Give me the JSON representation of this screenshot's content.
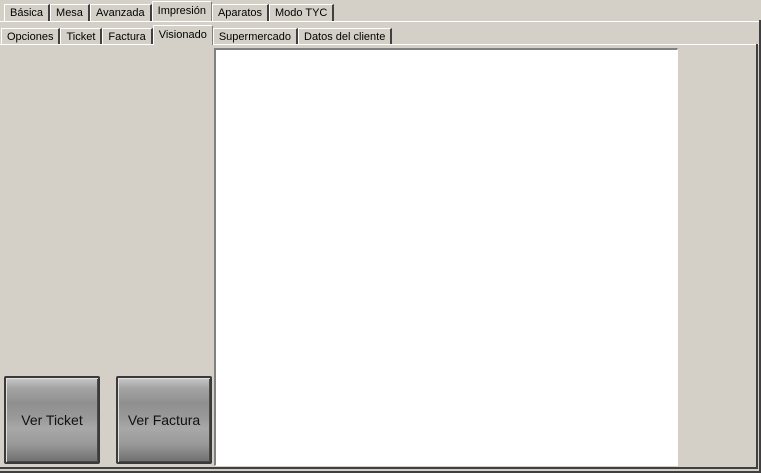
{
  "top_tabs": [
    "Básica",
    "Mesa",
    "Avanzada",
    "Impresión",
    "Aparatos",
    "Modo TYC"
  ],
  "top_tabs_selected": "Impresión",
  "sub_tabs": [
    "Opciones",
    "Ticket",
    "Factura",
    "Visionado",
    "Supermercado",
    "Datos del cliente"
  ],
  "sub_tabs_selected": "Visionado",
  "buttons": {
    "ver_ticket": "Ver Ticket",
    "ver_factura": "Ver Factura"
  }
}
